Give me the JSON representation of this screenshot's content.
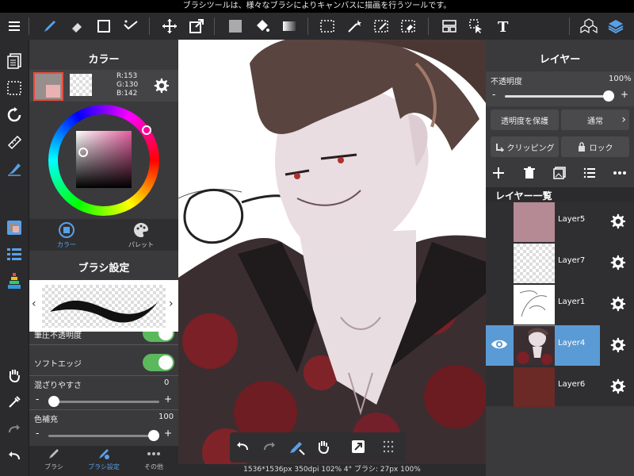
{
  "status_hint": "ブラシツールは、様々なブラシによりキャンバスに描画を行うツールです。",
  "color_panel": {
    "title": "カラー",
    "rgb": {
      "r": "R:153",
      "g": "G:130",
      "b": "B:142"
    },
    "current_color": "#998e8e",
    "tabs": [
      {
        "label": "カラー"
      },
      {
        "label": "パレット"
      }
    ]
  },
  "brush_panel": {
    "title": "ブラシ設定",
    "partial_label": "筆圧不透明度",
    "soft_edge_label": "ソフトエッジ",
    "blend_label": "混ざりやすさ",
    "blend_value": "0",
    "blend_fraction": 0.0,
    "fill_label": "色補充",
    "fill_value": "100",
    "fill_fraction": 1.0,
    "minus": "-",
    "plus": "+"
  },
  "left_bottom_tabs": [
    {
      "label": "ブラシ"
    },
    {
      "label": "ブラシ設定"
    },
    {
      "label": "その他"
    }
  ],
  "layer_panel": {
    "title": "レイヤー",
    "opacity_label": "不透明度",
    "opacity_value": "100%",
    "opacity_fraction": 1.0,
    "minus": "-",
    "plus": "+",
    "protect_label": "透明度を保護",
    "blend_mode": "通常",
    "clipping_label": "クリッピング",
    "lock_label": "ロック",
    "list_title": "レイヤー一覧",
    "layers": [
      {
        "name": "Layer5",
        "color": "#b58a94"
      },
      {
        "name": "Layer7",
        "color": "checker"
      },
      {
        "name": "Layer1",
        "color": "sketch"
      },
      {
        "name": "Layer4",
        "color": "portrait"
      },
      {
        "name": "Layer6",
        "color": "#6b2a26"
      }
    ],
    "selected_layer": "Layer4"
  },
  "canvas_info": "1536*1536px 350dpi 102% 4° ブラシ: 27px 100%",
  "colors": {
    "accent": "#5aa0e6",
    "selected_layer_bg": "#5b9bd5",
    "toggle": "#5cb85c"
  }
}
